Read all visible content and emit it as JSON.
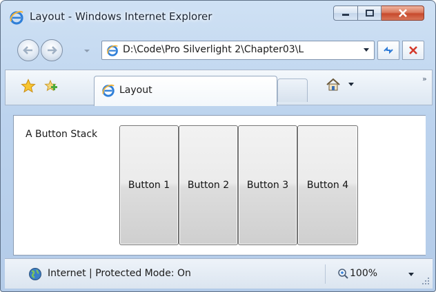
{
  "window": {
    "title": "Layout - Windows Internet Explorer"
  },
  "address": {
    "url": "D:\\Code\\Pro Silverlight 2\\Chapter03\\L"
  },
  "tabs": [
    {
      "label": "Layout"
    }
  ],
  "content": {
    "stack_label": "A Button Stack",
    "buttons": [
      "Button 1",
      "Button 2",
      "Button 3",
      "Button 4"
    ]
  },
  "status": {
    "zone": "Internet | Protected Mode: On",
    "zoom": "100%"
  },
  "icons": {
    "ie": "ie-logo-icon",
    "back": "back-arrow-icon",
    "forward": "forward-arrow-icon",
    "refresh": "refresh-icon",
    "stop": "stop-icon",
    "favorites": "favorites-star-icon",
    "add_favorites": "add-favorites-icon",
    "home": "home-icon",
    "globe": "globe-icon",
    "zoom": "zoom-icon"
  },
  "colors": {
    "window_frame": "#bcd3ee",
    "close_button": "#c74a2c",
    "content_bg": "#ffffff"
  }
}
